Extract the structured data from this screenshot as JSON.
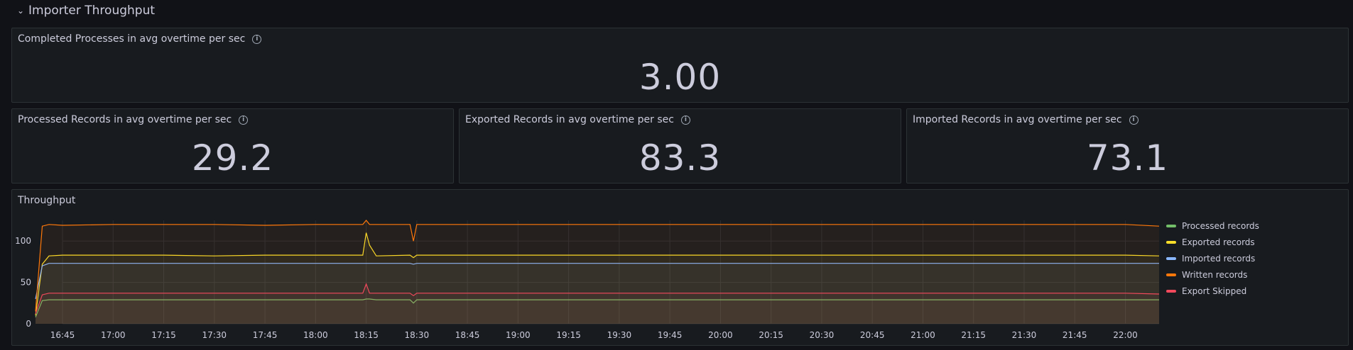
{
  "row": {
    "title": "Importer Throughput",
    "chevron_icon": "chevron-down-icon"
  },
  "panels": {
    "completed": {
      "title": "Completed Processes in avg overtime per sec",
      "value": "3.00"
    },
    "processed": {
      "title": "Processed Records in avg overtime per sec",
      "value": "29.2"
    },
    "exported": {
      "title": "Exported Records in avg overtime per sec",
      "value": "83.3"
    },
    "imported": {
      "title": "Imported Records in avg overtime per sec",
      "value": "73.1"
    },
    "throughput": {
      "title": "Throughput"
    }
  },
  "chart_data": {
    "type": "line",
    "title": "Throughput",
    "xlabel": "",
    "ylabel": "",
    "ylim": [
      0,
      125
    ],
    "xlim": [
      "16:37",
      "22:10"
    ],
    "yticks": [
      0,
      50,
      100
    ],
    "xticks": [
      "16:45",
      "17:00",
      "17:15",
      "17:30",
      "17:45",
      "18:00",
      "18:15",
      "18:30",
      "18:45",
      "19:00",
      "19:15",
      "19:30",
      "19:45",
      "20:00",
      "20:15",
      "20:30",
      "20:45",
      "21:00",
      "21:15",
      "21:30",
      "21:45",
      "22:00"
    ],
    "grid": true,
    "legend_position": "right",
    "x": [
      "16:37",
      "16:39",
      "16:41",
      "16:45",
      "17:00",
      "17:15",
      "17:30",
      "17:45",
      "18:00",
      "18:10",
      "18:14",
      "18:15",
      "18:16",
      "18:18",
      "18:28",
      "18:29",
      "18:30",
      "18:45",
      "19:00",
      "19:15",
      "19:30",
      "19:45",
      "20:00",
      "20:15",
      "20:30",
      "20:45",
      "21:00",
      "21:15",
      "21:30",
      "21:45",
      "22:00",
      "22:10"
    ],
    "series": [
      {
        "name": "Processed records",
        "color": "#73bf69",
        "values": [
          8,
          28,
          29,
          29,
          29,
          29,
          29,
          29,
          29,
          29,
          29,
          30,
          30,
          29,
          29,
          25,
          29,
          29,
          29,
          29,
          29,
          29,
          29,
          29,
          29,
          29,
          29,
          29,
          29,
          29,
          29,
          29
        ]
      },
      {
        "name": "Exported records",
        "color": "#fade2a",
        "values": [
          10,
          72,
          82,
          83,
          83,
          83,
          82,
          83,
          83,
          83,
          83,
          110,
          95,
          82,
          83,
          80,
          83,
          83,
          83,
          83,
          83,
          83,
          83,
          83,
          83,
          83,
          83,
          83,
          83,
          83,
          83,
          82
        ]
      },
      {
        "name": "Imported records",
        "color": "#8ab8ff",
        "values": [
          30,
          70,
          73,
          73,
          73,
          73,
          73,
          73,
          73,
          73,
          73,
          73,
          73,
          73,
          73,
          72,
          73,
          73,
          73,
          73,
          73,
          73,
          73,
          73,
          73,
          73,
          73,
          73,
          73,
          73,
          73,
          73
        ]
      },
      {
        "name": "Written records",
        "color": "#ff780a",
        "values": [
          15,
          118,
          120,
          119,
          120,
          120,
          120,
          119,
          120,
          120,
          120,
          125,
          120,
          120,
          120,
          100,
          120,
          120,
          120,
          120,
          120,
          120,
          120,
          120,
          120,
          120,
          120,
          120,
          120,
          120,
          120,
          118
        ]
      },
      {
        "name": "Export Skipped",
        "color": "#f2495c",
        "values": [
          12,
          35,
          37,
          37,
          37,
          37,
          37,
          37,
          37,
          37,
          37,
          48,
          37,
          37,
          37,
          34,
          37,
          37,
          37,
          37,
          37,
          37,
          37,
          37,
          37,
          37,
          37,
          37,
          37,
          37,
          37,
          36
        ]
      }
    ]
  }
}
